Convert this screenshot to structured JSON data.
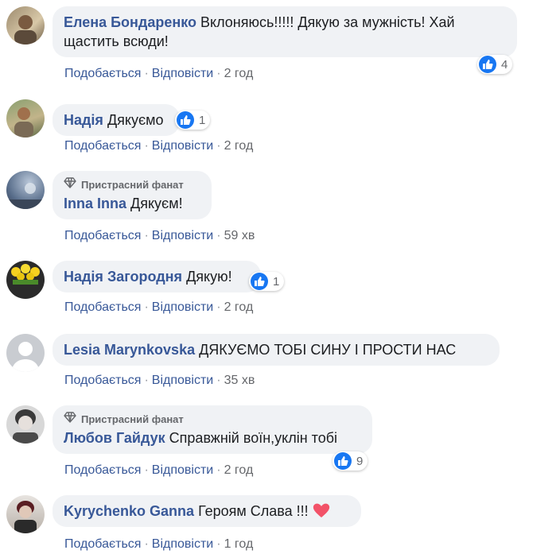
{
  "actions": {
    "like": "Подобається",
    "reply": "Відповісти",
    "separator": "·"
  },
  "fan_badge": "Пристрасний фанат",
  "comments": [
    {
      "author": "Елена Бондаренко",
      "text": "Вклоняюсь!!!!! Дякую за мужність! Хай щастить всюди!",
      "time": "2 год",
      "reactions": "4"
    },
    {
      "author": "Надія",
      "text": "Дякуємо",
      "time": "2 год",
      "reactions": "1"
    },
    {
      "author": "Inna Inna",
      "text": "Дякуєм!",
      "time": "59 хв"
    },
    {
      "author": "Надія Загородня",
      "text": "Дякую!",
      "time": "2 год",
      "reactions": "1"
    },
    {
      "author": "Lesia Marynkovska",
      "text": "ДЯКУЄМО ТОБІ СИНУ І ПРОСТИ НАС",
      "time": "35 хв"
    },
    {
      "author": "Любов Гайдук",
      "text": "Справжній воїн,уклін тобі",
      "time": "2 год",
      "reactions": "9"
    },
    {
      "author": "Kyrychenko Ganna",
      "text": "Героям Слава !!!",
      "time": "1 год"
    }
  ],
  "icons": {
    "like": "like-icon",
    "diamond": "diamond-icon",
    "heart": "heart-icon"
  },
  "colors": {
    "author": "#385898",
    "bubble": "#f0f2f5",
    "like_blue": "#1877f2",
    "heart": "#f25268"
  }
}
